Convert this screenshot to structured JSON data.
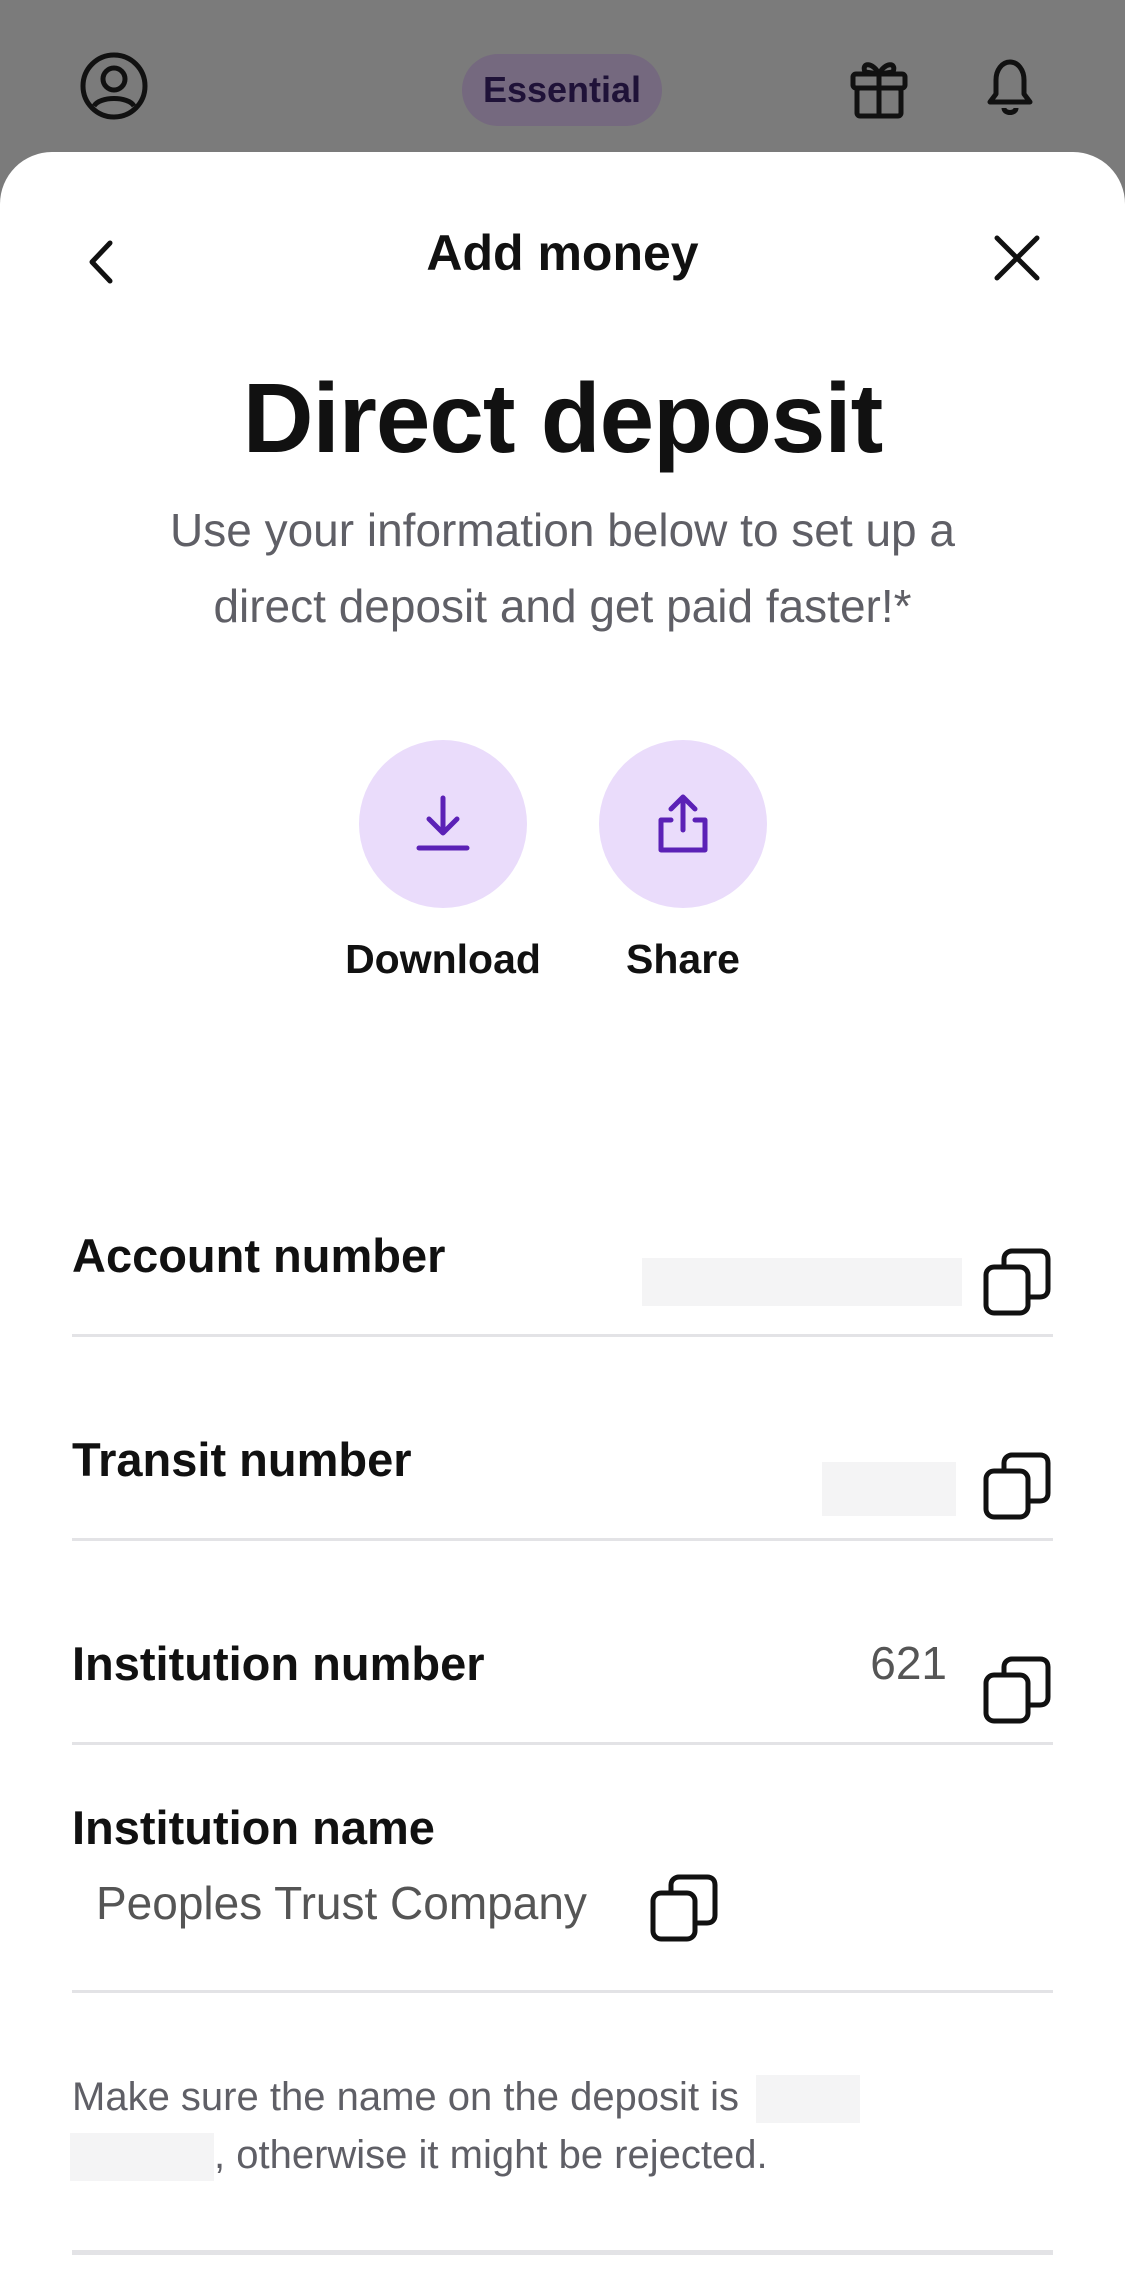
{
  "topbar": {
    "plan_badge": "Essential"
  },
  "sheet": {
    "header_title": "Add money",
    "title": "Direct deposit",
    "subtitle": "Use your information below to set up a direct deposit and get paid faster!*",
    "actions": [
      {
        "label": "Download",
        "icon": "download-icon"
      },
      {
        "label": "Share",
        "icon": "share-icon"
      }
    ],
    "fields": {
      "account_label": "Account number",
      "account_value": "",
      "transit_label": "Transit number",
      "transit_value": "",
      "institution_number_label": "Institution number",
      "institution_number_value": "621",
      "institution_name_label": "Institution name",
      "institution_name_value": "Peoples Trust Company"
    },
    "note_prefix": "Make sure the name on the deposit is",
    "note_suffix": ", otherwise it might be rejected."
  },
  "colors": {
    "accent": "#5b21b6",
    "accent_light": "#eadcfb",
    "overlay": "#7b7b7b"
  }
}
